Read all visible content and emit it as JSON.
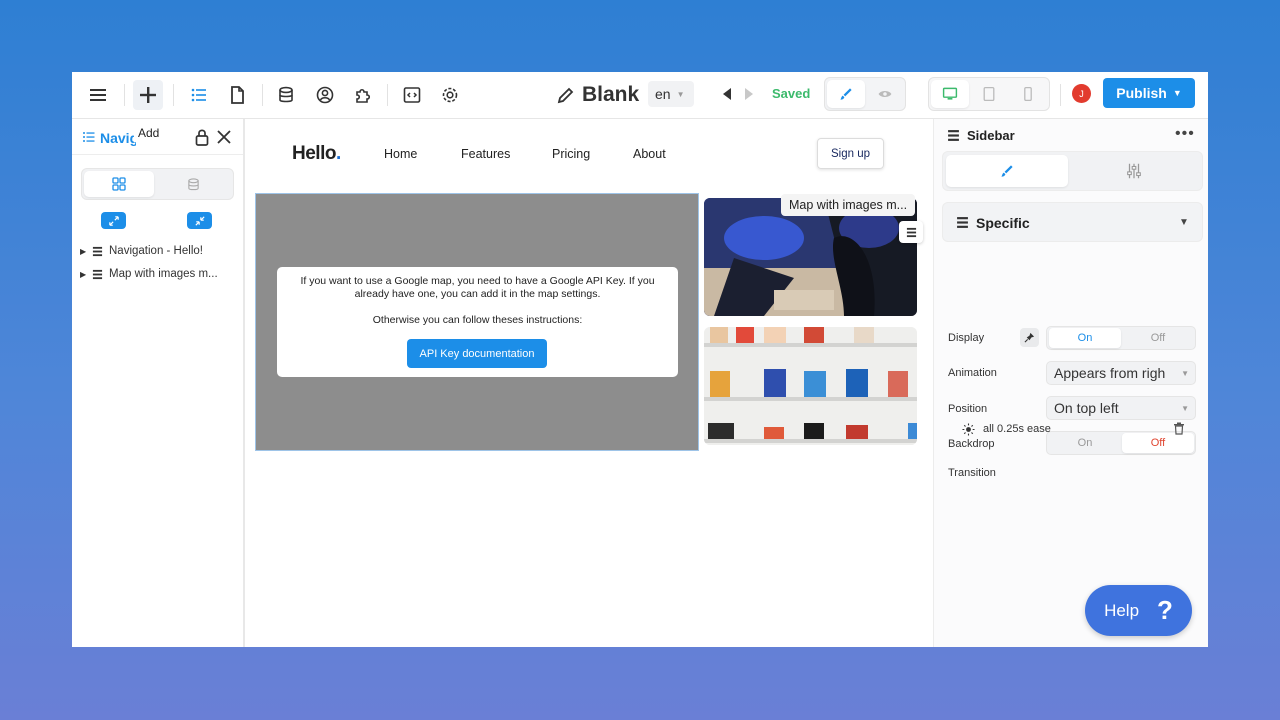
{
  "toolbar": {
    "add_tooltip": "Add",
    "title": "Blank",
    "language": "en",
    "status": "Saved",
    "avatar_initial": "J",
    "publish_label": "Publish"
  },
  "left_panel": {
    "title": "Navigation",
    "tree": [
      {
        "label": "Navigation - Hello!"
      },
      {
        "label": "Map with images m..."
      }
    ]
  },
  "canvas": {
    "logo_text": "Hello",
    "logo_dot": ".",
    "nav_links": [
      "Home",
      "Features",
      "Pricing",
      "About"
    ],
    "signup_label": "Sign up",
    "map_message": "If you want to use a Google map, you need to have a Google API Key. If you already have one, you can add it in the map settings.",
    "map_message2": "Otherwise you can follow theses instructions:",
    "api_button": "API Key documentation",
    "block_label": "Map with images m..."
  },
  "right_panel": {
    "title": "Sidebar",
    "section_title": "Specific",
    "properties": {
      "display_label": "Display",
      "display_on": "On",
      "display_off": "Off",
      "animation_label": "Animation",
      "animation_value": "Appears from righ",
      "position_label": "Position",
      "position_value": "On top left",
      "backdrop_label": "Backdrop",
      "backdrop_on": "On",
      "backdrop_off": "Off",
      "transition_label": "Transition",
      "transition_value": "all 0.25s ease"
    }
  },
  "help": {
    "label": "Help",
    "icon": "?"
  },
  "colors": {
    "accent": "#1c8ee8",
    "saved": "#3cba6c",
    "off_active": "#e0442f",
    "help": "#3f73de"
  }
}
